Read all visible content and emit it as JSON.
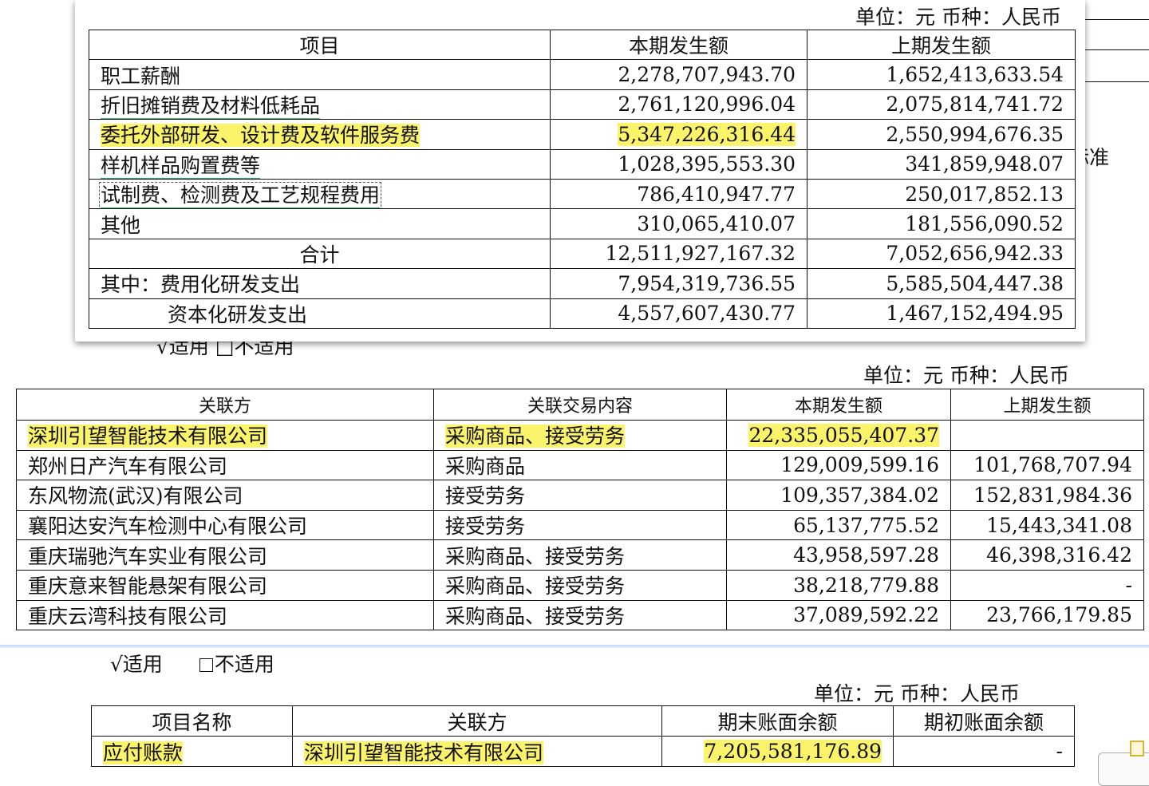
{
  "rd_table": {
    "unit_label": "单位：元    币种：人民币",
    "headers": [
      "项目",
      "本期发生额",
      "上期发生额"
    ],
    "rows": [
      [
        "职工薪酬",
        "2,278,707,943.70",
        "1,652,413,633.54"
      ],
      [
        "折旧摊销费及材料低耗品",
        "2,761,120,996.04",
        "2,075,814,741.72"
      ],
      [
        "委托外部研发、设计费及软件服务费",
        "5,347,226,316.44",
        "2,550,994,676.35"
      ],
      [
        "样机样品购置费等",
        "1,028,395,553.30",
        "341,859,948.07"
      ],
      [
        "试制费、检测费及工艺规程费用",
        "786,410,947.77",
        "250,017,852.13"
      ],
      [
        "其他",
        "310,065,410.07",
        "181,556,090.52"
      ],
      [
        "合计",
        "12,511,927,167.32",
        "7,052,656,942.33"
      ],
      [
        "其中：费用化研发支出",
        "7,954,319,736.55",
        "5,585,504,447.38"
      ],
      [
        "资本化研发支出",
        "4,557,607,430.77",
        "1,467,152,494.95"
      ]
    ]
  },
  "background": {
    "side_fragment": "标准",
    "hidden_options": "√适用  □不适用"
  },
  "related_party_table": {
    "unit_label": "单位：元    币种：人民币",
    "headers": [
      "关联方",
      "关联交易内容",
      "本期发生额",
      "上期发生额"
    ],
    "rows": [
      [
        "深圳引望智能技术有限公司",
        "采购商品、接受劳务",
        "22,335,055,407.37",
        ""
      ],
      [
        "郑州日产汽车有限公司",
        "采购商品",
        "129,009,599.16",
        "101,768,707.94"
      ],
      [
        "东风物流(武汉)有限公司",
        "接受劳务",
        "109,357,384.02",
        "152,831,984.36"
      ],
      [
        "襄阳达安汽车检测中心有限公司",
        "接受劳务",
        "65,137,775.52",
        "15,443,341.08"
      ],
      [
        "重庆瑞驰汽车实业有限公司",
        "采购商品、接受劳务",
        "43,958,597.28",
        "46,398,316.42"
      ],
      [
        "重庆意来智能悬架有限公司",
        "采购商品、接受劳务",
        "38,218,779.88",
        "-"
      ],
      [
        "重庆云湾科技有限公司",
        "采购商品、接受劳务",
        "37,089,592.22",
        "23,766,179.85"
      ]
    ]
  },
  "applicability": {
    "applicable": "√适用",
    "not_applicable": "不适用"
  },
  "payable_table": {
    "unit_label": "单位：元    币种：人民币",
    "headers": [
      "项目名称",
      "关联方",
      "期末账面余额",
      "期初账面余额"
    ],
    "rows": [
      [
        "应付账款",
        "深圳引望智能技术有限公司",
        "7,205,581,176.89",
        "-"
      ]
    ]
  },
  "colors": {
    "highlight": "#fbf36a",
    "underline_green": "#2bb673",
    "page_break_blue": "#bcd6f5"
  }
}
